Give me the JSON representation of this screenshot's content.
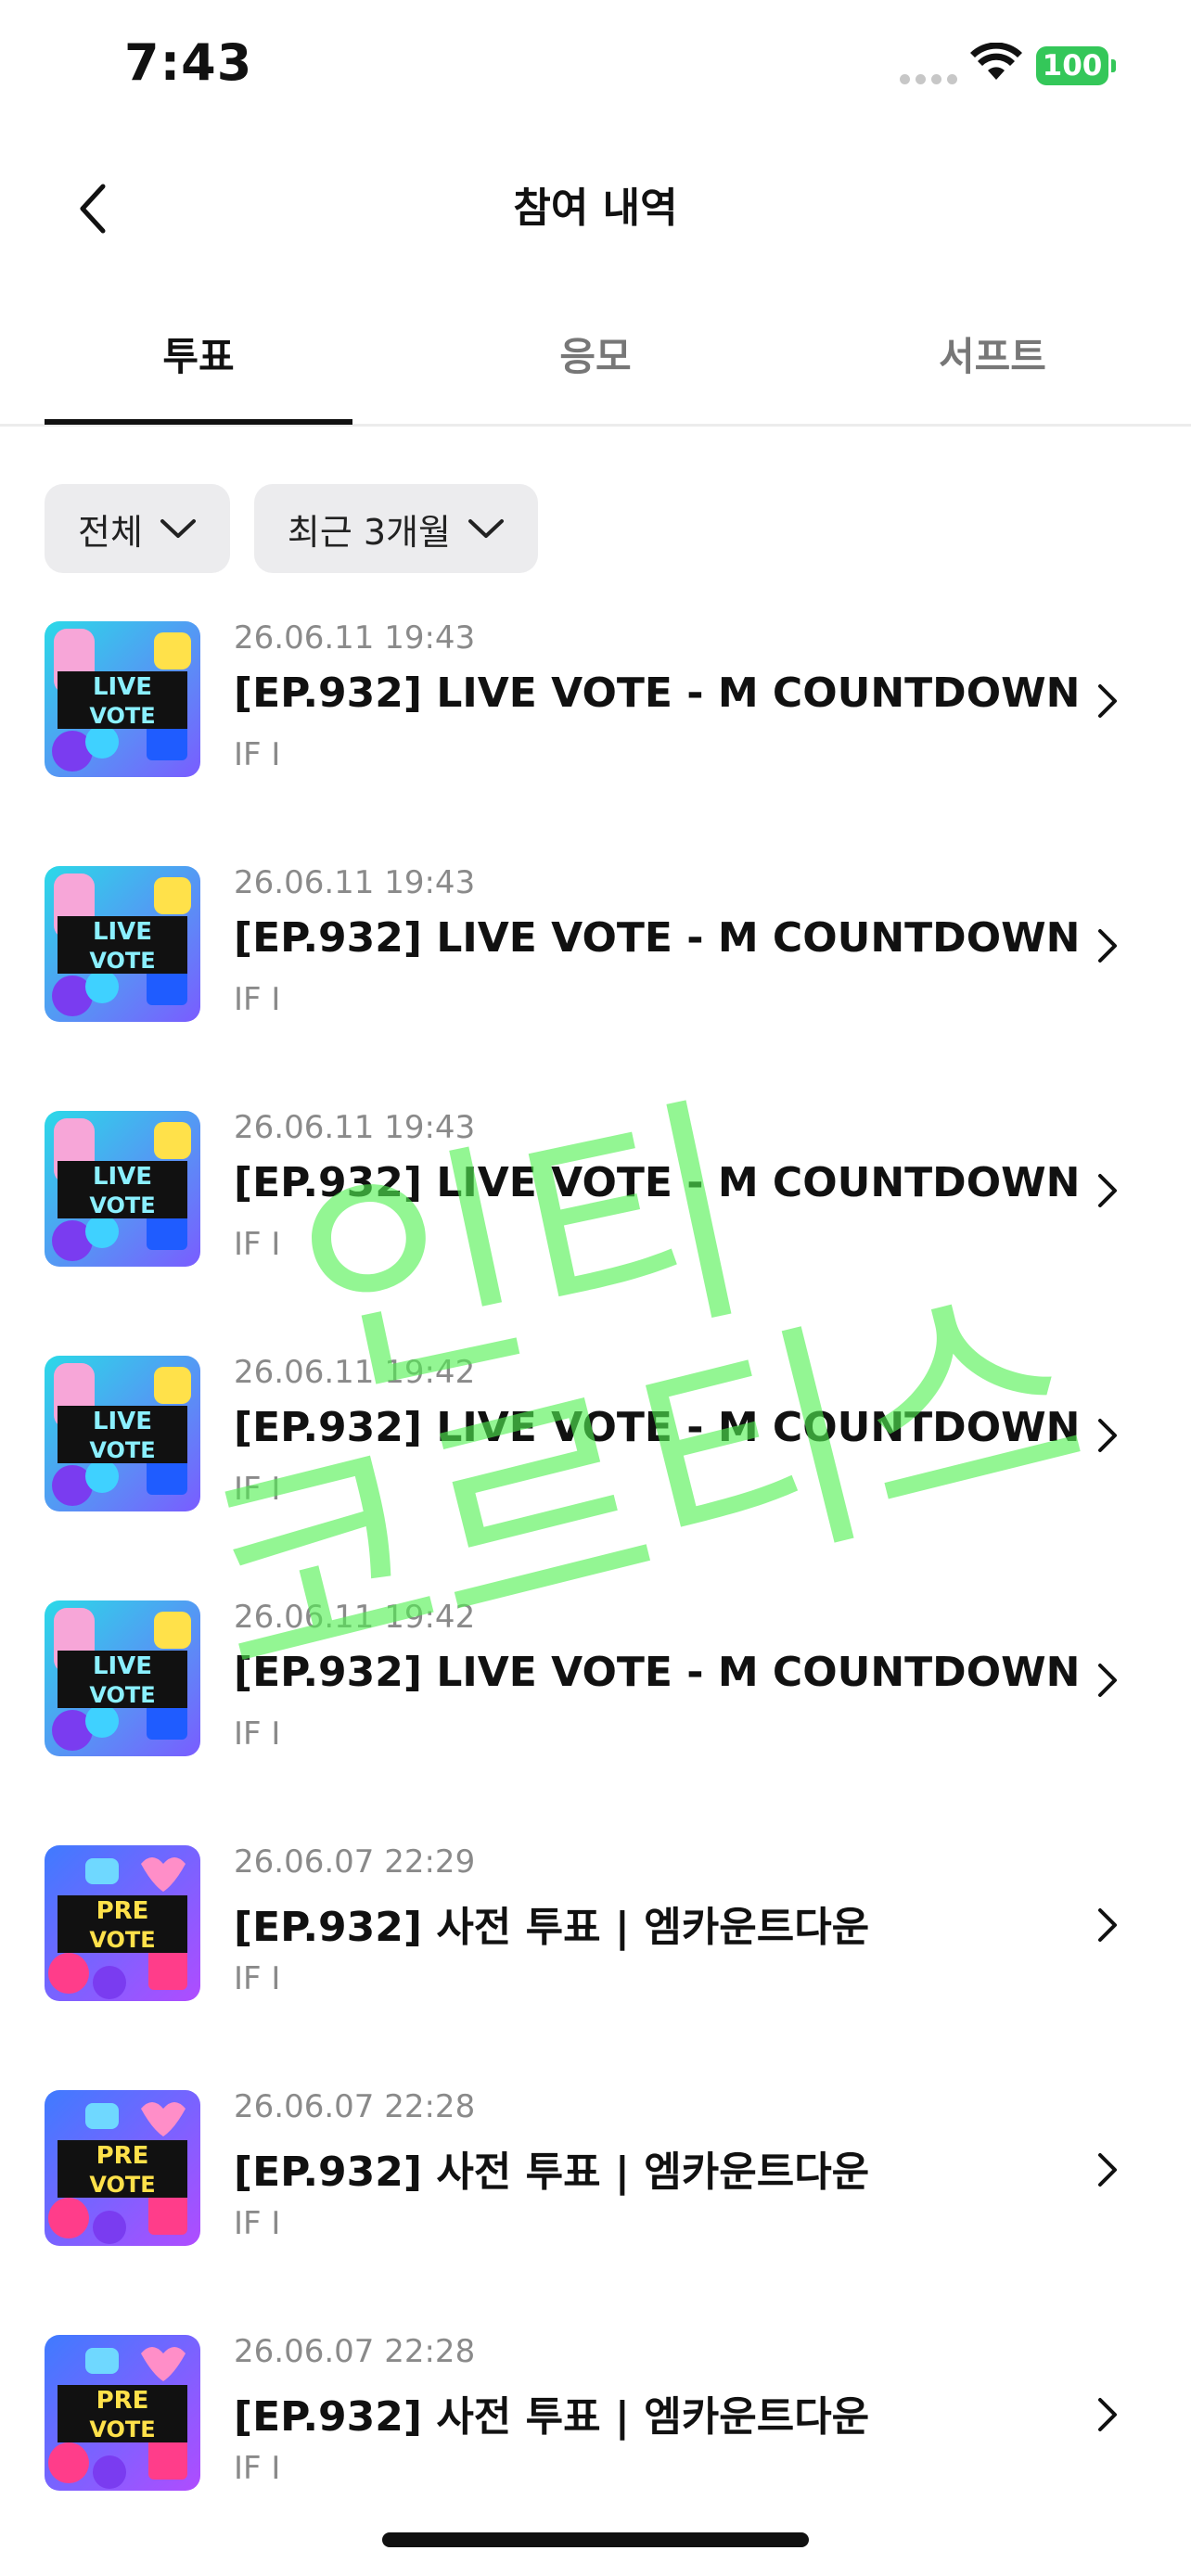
{
  "status_bar": {
    "time": "7:43",
    "battery": "100"
  },
  "header": {
    "title": "참여 내역",
    "back_icon": "chevron-left-icon"
  },
  "tabs": [
    {
      "label": "투표",
      "active": true
    },
    {
      "label": "응모",
      "active": false
    },
    {
      "label": "서프트",
      "active": false
    }
  ],
  "filters": [
    {
      "label": "전체",
      "icon": "chevron-down-icon"
    },
    {
      "label": "최근 3개월",
      "icon": "chevron-down-icon"
    }
  ],
  "votes": [
    {
      "date": "26.06.11 19:43",
      "title": "[EP.932] LIVE VOTE - M COUNTDOWN",
      "subtitle": "IF I",
      "thumb": "live-vote"
    },
    {
      "date": "26.06.11 19:43",
      "title": "[EP.932] LIVE VOTE - M COUNTDOWN",
      "subtitle": "IF I",
      "thumb": "live-vote"
    },
    {
      "date": "26.06.11 19:43",
      "title": "[EP.932] LIVE VOTE - M COUNTDOWN",
      "subtitle": "IF I",
      "thumb": "live-vote"
    },
    {
      "date": "26.06.11 19:42",
      "title": "[EP.932] LIVE VOTE - M COUNTDOWN",
      "subtitle": "IF I",
      "thumb": "live-vote"
    },
    {
      "date": "26.06.11 19:42",
      "title": "[EP.932] LIVE VOTE - M COUNTDOWN",
      "subtitle": "IF I",
      "thumb": "live-vote"
    },
    {
      "date": "26.06.07 22:29",
      "title": "[EP.932] 사전 투표 | 엠카운트다운",
      "subtitle": "IF I",
      "thumb": "pre-vote"
    },
    {
      "date": "26.06.07 22:28",
      "title": "[EP.932] 사전 투표 | 엠카운트다운",
      "subtitle": "IF I",
      "thumb": "pre-vote"
    },
    {
      "date": "26.06.07 22:28",
      "title": "[EP.932] 사전 투표 | 엠카운트다운",
      "subtitle": "IF I",
      "thumb": "pre-vote"
    }
  ],
  "thumb_labels": {
    "live-vote": {
      "line1": "LIVE",
      "line2": "VOTE"
    },
    "pre-vote": {
      "line1": "PRE",
      "line2": "VOTE"
    }
  },
  "watermark": {
    "line1": "인티",
    "line2": "코르티스",
    "color": "#50f050"
  },
  "colors": {
    "accent": "#111111",
    "muted": "#8a8a8a",
    "chip_bg": "#ececee",
    "battery": "#34c759"
  }
}
